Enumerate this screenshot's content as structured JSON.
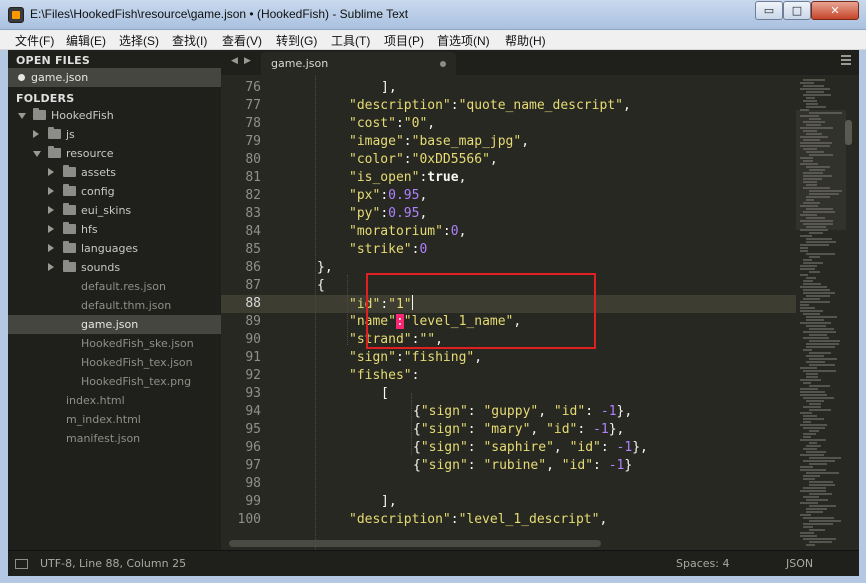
{
  "window": {
    "title": "E:\\Files\\HookedFish\\resource\\game.json • (HookedFish) - Sublime Text",
    "min_glyph": "▭",
    "max_glyph": "□",
    "close_glyph": "✕"
  },
  "menu": [
    {
      "label": "文件(F)"
    },
    {
      "label": "编辑(E)"
    },
    {
      "label": "选择(S)"
    },
    {
      "label": "查找(I)"
    },
    {
      "label": "查看(V)"
    },
    {
      "label": "转到(G)"
    },
    {
      "label": "工具(T)"
    },
    {
      "label": "项目(P)"
    },
    {
      "label": "首选项(N)"
    },
    {
      "label": "帮助(H)"
    }
  ],
  "sidebar": {
    "open_files_header": "OPEN FILES",
    "open_files": [
      {
        "label": "game.json"
      }
    ],
    "folders_header": "FOLDERS",
    "tree": [
      {
        "label": "HookedFish",
        "depth": 0,
        "type": "folder",
        "expanded": true
      },
      {
        "label": "js",
        "depth": 1,
        "type": "folder",
        "expanded": false
      },
      {
        "label": "resource",
        "depth": 1,
        "type": "folder",
        "expanded": true
      },
      {
        "label": "assets",
        "depth": 2,
        "type": "folder",
        "expanded": false
      },
      {
        "label": "config",
        "depth": 2,
        "type": "folder",
        "expanded": false
      },
      {
        "label": "eui_skins",
        "depth": 2,
        "type": "folder",
        "expanded": false
      },
      {
        "label": "hfs",
        "depth": 2,
        "type": "folder",
        "expanded": false
      },
      {
        "label": "languages",
        "depth": 2,
        "type": "folder",
        "expanded": false
      },
      {
        "label": "sounds",
        "depth": 2,
        "type": "folder",
        "expanded": false
      },
      {
        "label": "default.res.json",
        "depth": 2,
        "type": "file"
      },
      {
        "label": "default.thm.json",
        "depth": 2,
        "type": "file"
      },
      {
        "label": "game.json",
        "depth": 2,
        "type": "file",
        "selected": true
      },
      {
        "label": "HookedFish_ske.json",
        "depth": 2,
        "type": "file"
      },
      {
        "label": "HookedFish_tex.json",
        "depth": 2,
        "type": "file"
      },
      {
        "label": "HookedFish_tex.png",
        "depth": 2,
        "type": "file"
      },
      {
        "label": "index.html",
        "depth": 1,
        "type": "file"
      },
      {
        "label": "m_index.html",
        "depth": 1,
        "type": "file"
      },
      {
        "label": "manifest.json",
        "depth": 1,
        "type": "file"
      }
    ]
  },
  "tabs": {
    "nav_left": "◀",
    "nav_right": "▶",
    "active": "game.json"
  },
  "editor": {
    "current_line": 88,
    "lines": [
      {
        "n": "76",
        "indent": 2,
        "parts": [
          [
            "p",
            "],"
          ]
        ]
      },
      {
        "n": "77",
        "indent": 1,
        "parts": [
          [
            "s",
            "\"description\""
          ],
          [
            "p",
            ":"
          ],
          [
            "s",
            "\"quote_name_descript\""
          ],
          [
            "p",
            ","
          ]
        ]
      },
      {
        "n": "78",
        "indent": 1,
        "parts": [
          [
            "s",
            "\"cost\""
          ],
          [
            "p",
            ":"
          ],
          [
            "s",
            "\"0\""
          ],
          [
            "p",
            ","
          ]
        ]
      },
      {
        "n": "79",
        "indent": 1,
        "parts": [
          [
            "s",
            "\"image\""
          ],
          [
            "p",
            ":"
          ],
          [
            "s",
            "\"base_map_jpg\""
          ],
          [
            "p",
            ","
          ]
        ]
      },
      {
        "n": "80",
        "indent": 1,
        "parts": [
          [
            "s",
            "\"color\""
          ],
          [
            "p",
            ":"
          ],
          [
            "s",
            "\"0xDD5566\""
          ],
          [
            "p",
            ","
          ]
        ]
      },
      {
        "n": "81",
        "indent": 1,
        "parts": [
          [
            "s",
            "\"is_open\""
          ],
          [
            "p",
            ":"
          ],
          [
            "k",
            "true"
          ],
          [
            "p",
            ","
          ]
        ]
      },
      {
        "n": "82",
        "indent": 1,
        "parts": [
          [
            "s",
            "\"px\""
          ],
          [
            "p",
            ":"
          ],
          [
            "n",
            "0.95"
          ],
          [
            "p",
            ","
          ]
        ]
      },
      {
        "n": "83",
        "indent": 1,
        "parts": [
          [
            "s",
            "\"py\""
          ],
          [
            "p",
            ":"
          ],
          [
            "n",
            "0.95"
          ],
          [
            "p",
            ","
          ]
        ]
      },
      {
        "n": "84",
        "indent": 1,
        "parts": [
          [
            "s",
            "\"moratorium\""
          ],
          [
            "p",
            ":"
          ],
          [
            "n",
            "0"
          ],
          [
            "p",
            ","
          ]
        ]
      },
      {
        "n": "85",
        "indent": 1,
        "parts": [
          [
            "s",
            "\"strike\""
          ],
          [
            "p",
            ":"
          ],
          [
            "n",
            "0"
          ]
        ]
      },
      {
        "n": "86",
        "indent": 0,
        "parts": [
          [
            "p",
            "},"
          ]
        ]
      },
      {
        "n": "87",
        "indent": 0,
        "parts": [
          [
            "p",
            "{"
          ]
        ]
      },
      {
        "n": "88",
        "indent": 1,
        "parts": [
          [
            "s",
            "\"id\""
          ],
          [
            "p",
            ":"
          ],
          [
            "s",
            "\"1\""
          ],
          [
            "c",
            ""
          ]
        ]
      },
      {
        "n": "89",
        "indent": 1,
        "parts": [
          [
            "s",
            "\"name\""
          ],
          [
            "e",
            ":"
          ],
          [
            "s",
            "\"level_1_name\""
          ],
          [
            "p",
            ","
          ]
        ]
      },
      {
        "n": "90",
        "indent": 1,
        "parts": [
          [
            "s",
            "\"strand\""
          ],
          [
            "p",
            ":"
          ],
          [
            "s",
            "\"\""
          ],
          [
            "p",
            ","
          ]
        ]
      },
      {
        "n": "91",
        "indent": 1,
        "parts": [
          [
            "s",
            "\"sign\""
          ],
          [
            "p",
            ":"
          ],
          [
            "s",
            "\"fishing\""
          ],
          [
            "p",
            ","
          ]
        ]
      },
      {
        "n": "92",
        "indent": 1,
        "parts": [
          [
            "s",
            "\"fishes\""
          ],
          [
            "p",
            ":"
          ]
        ]
      },
      {
        "n": "93",
        "indent": 2,
        "parts": [
          [
            "p",
            "["
          ]
        ]
      },
      {
        "n": "94",
        "indent": 3,
        "parts": [
          [
            "p",
            "{"
          ],
          [
            "s",
            "\"sign\""
          ],
          [
            "p",
            ": "
          ],
          [
            "s",
            "\"guppy\""
          ],
          [
            "p",
            ", "
          ],
          [
            "s",
            "\"id\""
          ],
          [
            "p",
            ": "
          ],
          [
            "n",
            "-1"
          ],
          [
            "p",
            "},"
          ]
        ]
      },
      {
        "n": "95",
        "indent": 3,
        "parts": [
          [
            "p",
            "{"
          ],
          [
            "s",
            "\"sign\""
          ],
          [
            "p",
            ": "
          ],
          [
            "s",
            "\"mary\""
          ],
          [
            "p",
            ", "
          ],
          [
            "s",
            "\"id\""
          ],
          [
            "p",
            ": "
          ],
          [
            "n",
            "-1"
          ],
          [
            "p",
            "},"
          ]
        ]
      },
      {
        "n": "96",
        "indent": 3,
        "parts": [
          [
            "p",
            "{"
          ],
          [
            "s",
            "\"sign\""
          ],
          [
            "p",
            ": "
          ],
          [
            "s",
            "\"saphire\""
          ],
          [
            "p",
            ", "
          ],
          [
            "s",
            "\"id\""
          ],
          [
            "p",
            ": "
          ],
          [
            "n",
            "-1"
          ],
          [
            "p",
            "},"
          ]
        ]
      },
      {
        "n": "97",
        "indent": 3,
        "parts": [
          [
            "p",
            "{"
          ],
          [
            "s",
            "\"sign\""
          ],
          [
            "p",
            ": "
          ],
          [
            "s",
            "\"rubine\""
          ],
          [
            "p",
            ", "
          ],
          [
            "s",
            "\"id\""
          ],
          [
            "p",
            ": "
          ],
          [
            "n",
            "-1"
          ],
          [
            "p",
            "}"
          ]
        ]
      },
      {
        "n": "98",
        "indent": 0,
        "parts": []
      },
      {
        "n": "99",
        "indent": 2,
        "parts": [
          [
            "p",
            "],"
          ]
        ]
      },
      {
        "n": "100",
        "indent": 1,
        "parts": [
          [
            "s",
            "\"description\""
          ],
          [
            "p",
            ":"
          ],
          [
            "s",
            "\"level_1_descript\""
          ],
          [
            "p",
            ","
          ]
        ]
      }
    ]
  },
  "status": {
    "position": "UTF-8, Line 88, Column 25",
    "spaces": "Spaces: 4",
    "syntax": "JSON"
  },
  "colors": {
    "string": "#e6db74",
    "number": "#ae81ff",
    "error_bg": "#f92672",
    "annotation_box": "#e02020"
  }
}
